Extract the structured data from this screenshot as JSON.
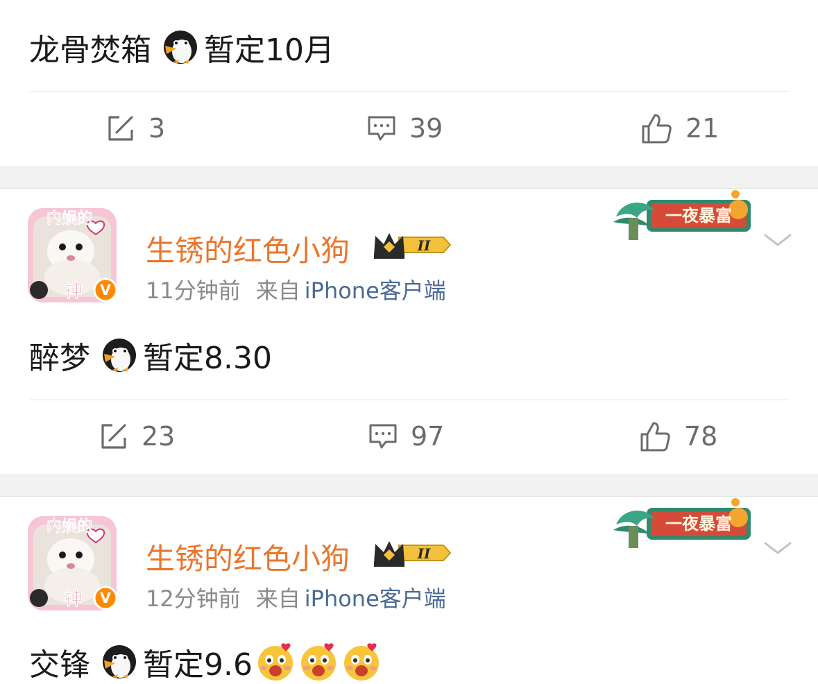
{
  "posts": [
    {
      "text_before": "龙骨焚箱",
      "text_after": "暂定10月",
      "repost_count": "3",
      "comment_count": "39",
      "like_count": "21"
    },
    {
      "author": "生锈的红色小狗",
      "level": "II",
      "avatar_text_top": "内娱的",
      "avatar_text_bottom": "神",
      "verified_mark": "V",
      "time": "11分钟前",
      "source_label": "来自",
      "source": "iPhone客户端",
      "badge_text": "一夜暴富",
      "text_before": "醉梦",
      "text_after": "暂定8.30",
      "repost_count": "23",
      "comment_count": "97",
      "like_count": "78"
    },
    {
      "author": "生锈的红色小狗",
      "level": "II",
      "avatar_text_top": "内娱的",
      "avatar_text_bottom": "神",
      "verified_mark": "V",
      "time": "12分钟前",
      "source_label": "来自",
      "source": "iPhone客户端",
      "badge_text": "一夜暴富",
      "text_before": "交锋",
      "text_after": "暂定9.6"
    }
  ],
  "icons": {
    "repost": "repost-icon",
    "comment": "comment-icon",
    "like": "thumbs-up-icon",
    "penguin": "penguin-emoji",
    "more": "chevron-down-icon",
    "crown": "crown-icon",
    "sticker": "love-face-sticker"
  },
  "colors": {
    "username": "#e8772e",
    "source_link": "#4a6a94",
    "meta_text": "#8a8a8a",
    "action_text": "#6b6b6b",
    "separator": "#f1f1f1",
    "badge_green": "#2f8a6e",
    "badge_red": "#d64a3a"
  }
}
